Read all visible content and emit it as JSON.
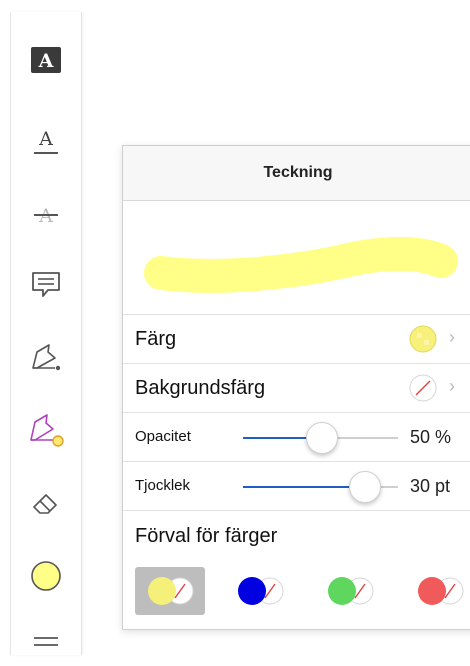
{
  "toolbar": {
    "tools": [
      {
        "name": "text-highlight-tool",
        "glyph": "A"
      },
      {
        "name": "text-underline-tool",
        "glyph": "A"
      },
      {
        "name": "text-strikethrough-tool",
        "glyph": "A"
      },
      {
        "name": "comment-tool"
      },
      {
        "name": "pen-tool"
      },
      {
        "name": "highlighter-pen-tool"
      },
      {
        "name": "eraser-tool"
      },
      {
        "name": "color-tool",
        "color": "#ffff88"
      },
      {
        "name": "menu-tool"
      }
    ]
  },
  "panel": {
    "title": "Teckning",
    "stroke_color": "#ffff88",
    "rows": {
      "color": {
        "label": "Färg",
        "chevron": "›",
        "swatch": "#f7f07a"
      },
      "background": {
        "label": "Bakgrundsfärg",
        "chevron": "›"
      },
      "opacity": {
        "label": "Opacitet",
        "value_text": "50 %",
        "value": 0.5
      },
      "thickness": {
        "label": "Tjocklek",
        "value_text": "30 pt",
        "value": 0.78
      }
    },
    "presets": {
      "label": "Förval för färger",
      "items": [
        {
          "color": "#f5f07a",
          "selected": true
        },
        {
          "color": "#0000e0",
          "selected": false
        },
        {
          "color": "#5fd75f",
          "selected": false
        },
        {
          "color": "#f05a5a",
          "selected": false
        }
      ]
    }
  }
}
